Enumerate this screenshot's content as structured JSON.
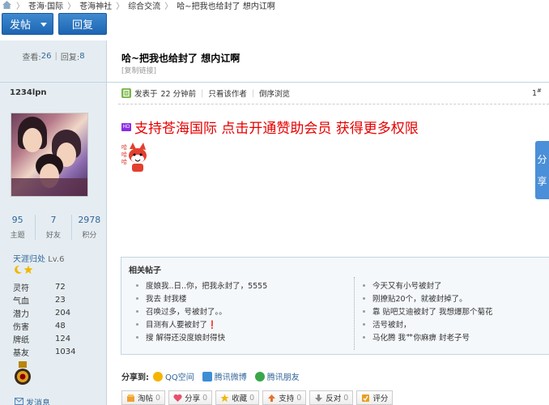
{
  "breadcrumb": {
    "items": [
      "苍海·国际",
      "苍海神社",
      "综合交流",
      "哈~把我也给封了 想内讧啊"
    ]
  },
  "buttons": {
    "post": "发帖",
    "reply": "回复"
  },
  "thread_stats": {
    "views_label": "查看:",
    "views": "26",
    "replies_label": "回复:",
    "replies": "8"
  },
  "thread": {
    "title": "哈~把我也给封了 想内讧啊",
    "copy_link": "[复制链接]"
  },
  "post": {
    "meta_prefix": "发表于",
    "time": "22 分钟前",
    "only_author": "只看该作者",
    "reverse": "倒序浏览",
    "floor": "1",
    "floor_sup": "#",
    "badge": "HD",
    "promo_text": "支持苍海国际 点击开通赞助会员 获得更多权限"
  },
  "user": {
    "name": "1234lpn",
    "stats": [
      {
        "value": "95",
        "label": "主题"
      },
      {
        "value": "7",
        "label": "好友"
      },
      {
        "value": "2978",
        "label": "积分"
      }
    ],
    "rank": "天涯归处",
    "level": "Lv.6",
    "attributes": [
      {
        "key": "灵符",
        "value": "72"
      },
      {
        "key": "气血",
        "value": "23"
      },
      {
        "key": "潜力",
        "value": "204"
      },
      {
        "key": "伤害",
        "value": "48"
      },
      {
        "key": "牌纸",
        "value": "124"
      },
      {
        "key": "基友",
        "value": "1034"
      }
    ],
    "pm_label": "发消息"
  },
  "share_float": {
    "line1": "分",
    "line2": "享"
  },
  "related": {
    "title": "相关帖子",
    "left": [
      "度娘我..日..你，把我永封了，5555",
      "我去 封我楼",
      "召唤过多，号被封了。。",
      "目测有人要被封了❗",
      "搜 解得还没度娘封得快"
    ],
    "right": [
      "今天又有小号被封了",
      "刚撩贴20个，就被封掉了。",
      "靠 贴吧艾迪被封了 我想爆那个菊花",
      "活号被封，",
      "马化腾 我艹你麻痹 封老子号"
    ]
  },
  "share": {
    "label": "分享到:",
    "services": [
      {
        "name": "QQ空间",
        "icon": "qzone-icon",
        "color": "#f5b400"
      },
      {
        "name": "腾讯微博",
        "icon": "tencent-weibo-icon",
        "color": "#3d8ed4"
      },
      {
        "name": "腾讯朋友",
        "icon": "tencent-friends-icon",
        "color": "#3aa64a"
      }
    ]
  },
  "actions": [
    {
      "label": "淘帖",
      "count": "0",
      "icon": "collect-thread-icon"
    },
    {
      "label": "分享",
      "count": "0",
      "icon": "heart-icon"
    },
    {
      "label": "收藏",
      "count": "0",
      "icon": "star-icon"
    },
    {
      "label": "支持",
      "count": "0",
      "icon": "thumb-up-icon"
    },
    {
      "label": "反对",
      "count": "0",
      "icon": "thumb-down-icon"
    },
    {
      "label": "评分",
      "count": "",
      "icon": "rate-icon"
    }
  ]
}
